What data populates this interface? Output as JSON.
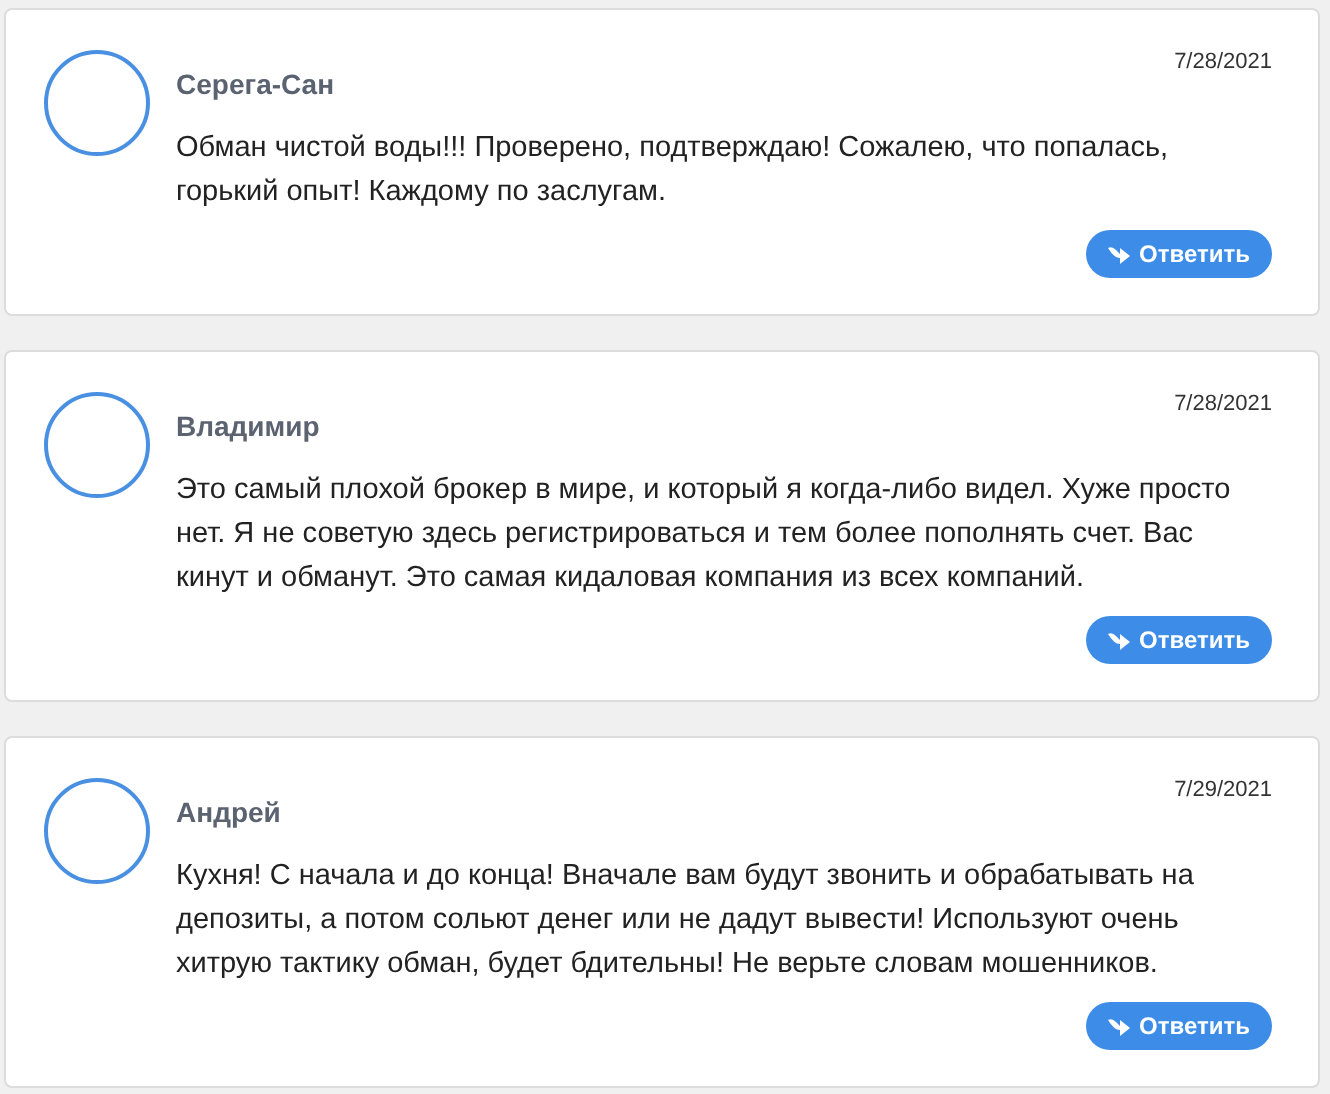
{
  "comments": [
    {
      "author": "Серега-Сан",
      "date": "7/28/2021",
      "text": "Обман чистой воды!!! Проверено, подтверждаю! Сожалею, что попалась, горький опыт! Каждому по заслугам.",
      "reply_label": "Ответить"
    },
    {
      "author": "Владимир",
      "date": "7/28/2021",
      "text": "Это самый плохой брокер в мире, и который я когда-либо видел. Хуже просто нет. Я не советую здесь регистрироваться и тем более пополнять счет. Вас кинут и обманут. Это самая кидаловая компания из всех компаний.",
      "reply_label": "Ответить"
    },
    {
      "author": "Андрей",
      "date": "7/29/2021",
      "text": "Кухня! С начала и до конца! Вначале вам будут звонить и обрабатывать на депозиты, а потом сольют денег или не дадут вывести! Используют очень хитрую тактику обман, будет бдительны! Не верьте словам мошенников.",
      "reply_label": "Ответить"
    }
  ]
}
